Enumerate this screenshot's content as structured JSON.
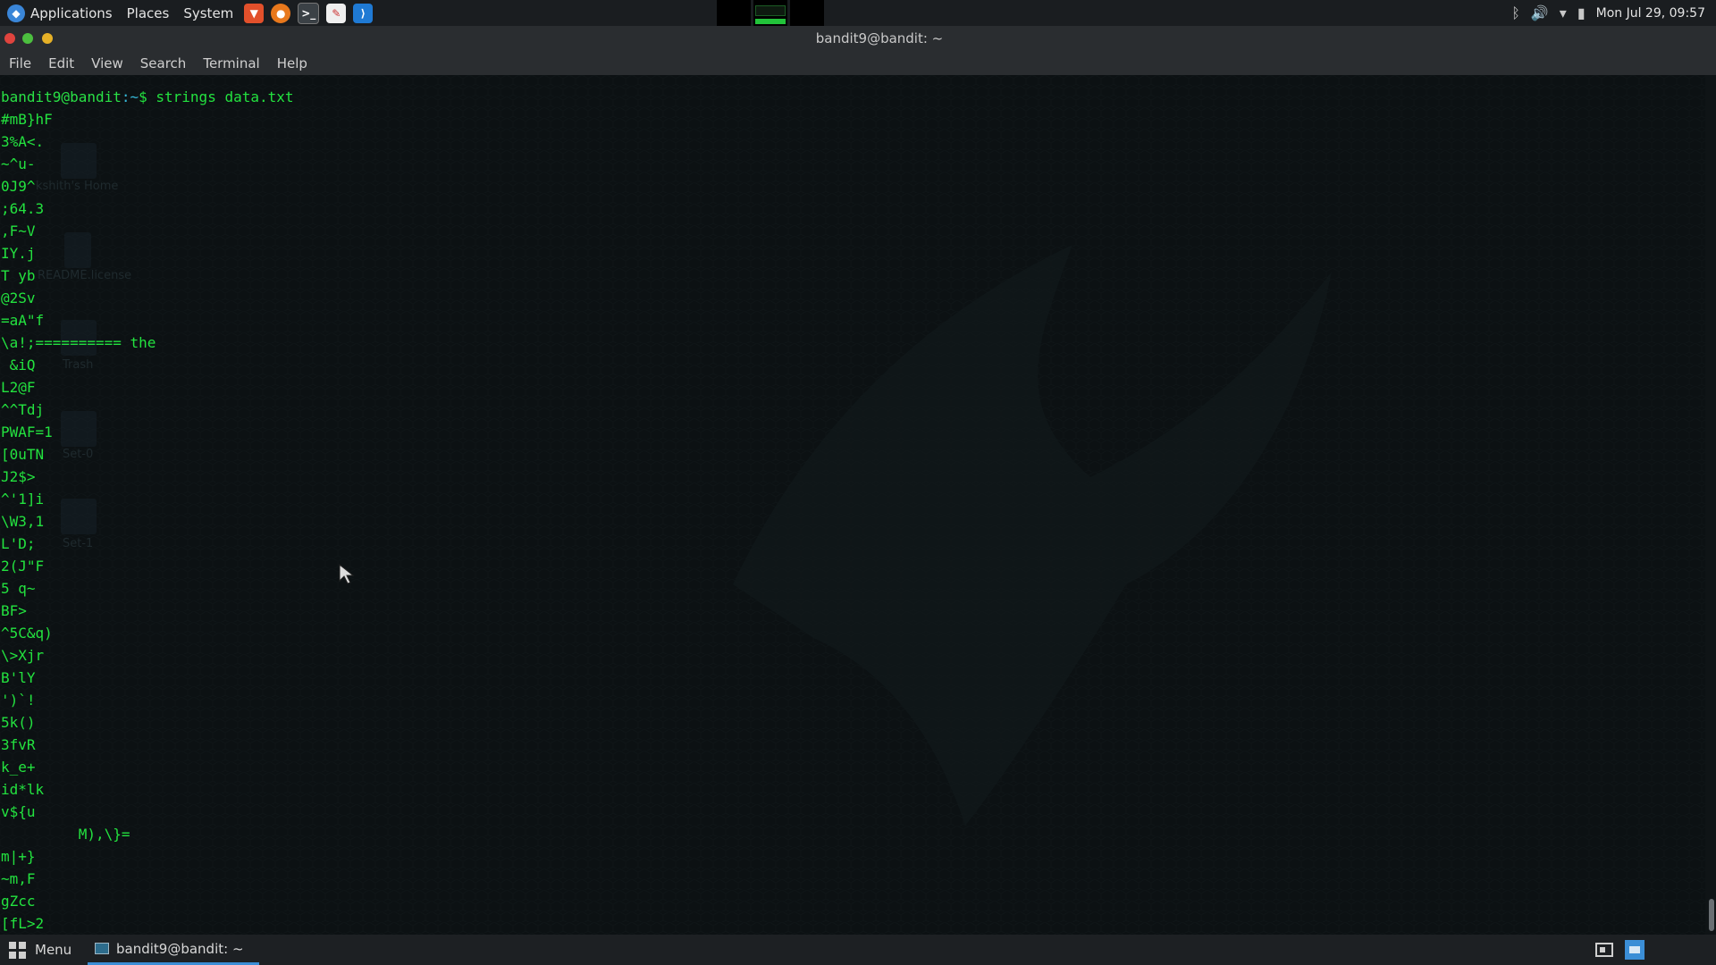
{
  "top_panel": {
    "applications": "Applications",
    "places": "Places",
    "system": "System",
    "clock": "Mon Jul 29, 09:57",
    "launchers": [
      "brave-browser-icon",
      "firefox-icon",
      "terminal-icon",
      "text-editor-icon",
      "vscode-icon"
    ]
  },
  "window": {
    "title": "bandit9@bandit: ~",
    "menu": [
      "File",
      "Edit",
      "View",
      "Search",
      "Terminal",
      "Help"
    ]
  },
  "terminal": {
    "prompt_user": "bandit9@bandit",
    "prompt_path": ":~",
    "prompt_symbol": "$ ",
    "command": "strings data.txt",
    "output": "#mB}hF\n3%A<.\n~^u-\n0J9^\n;64.3\n,F~V\nIY.j\nT yb\n@2Sv\n=aA\"f\n\\a!;========== the\n &iQ\nL2@F\n^^Tdj\nPWAF=1\n[0uTN\nJ2$>\n^'1]i\n\\W3,1\nL'D;\n2(J\"F\n5 q~\nBF>\n^5C&q)\n\\>Xjr\nB'lY\n')`!\n5k()\n3fvR\nk_e+\nid*lk\nv${u\n         M),\\}=\nm|+}\n~m,F\ngZcc\n[fL>2"
  },
  "desktop_icons": [
    "kshith's Home",
    "README.license",
    "Trash",
    "Set-0",
    "Set-1"
  ],
  "bottom_panel": {
    "menu_label": "Menu",
    "task_label": "bandit9@bandit: ~"
  },
  "colors": {
    "terminal_text": "#23e23f",
    "prompt_path": "#35b8d8",
    "accent": "#3b8ed6"
  }
}
